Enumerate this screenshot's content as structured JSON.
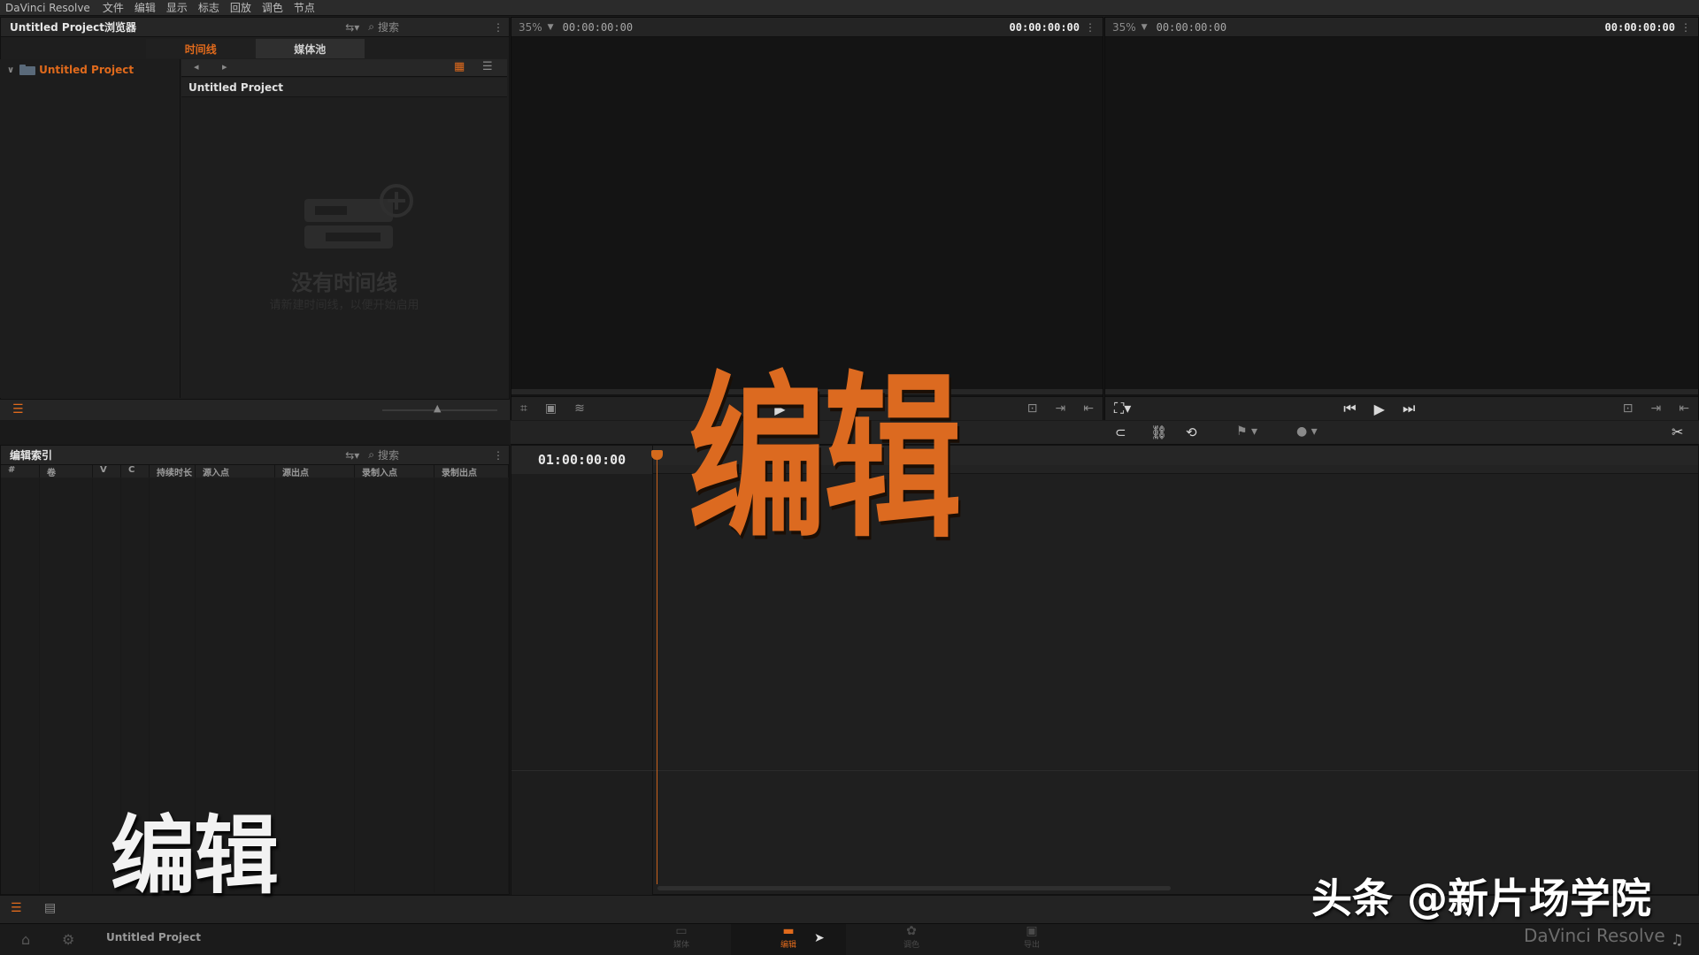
{
  "menubar": {
    "app": "DaVinci Resolve",
    "items": [
      "文件",
      "编辑",
      "显示",
      "标志",
      "回放",
      "调色",
      "节点"
    ]
  },
  "browser": {
    "title": "Untitled Project浏览器",
    "search_placeholder": "搜索",
    "tabs": [
      "时间线",
      "媒体池"
    ],
    "tree_root": "Untitled Project",
    "bin_title": "Untitled Project",
    "empty_title": "没有时间线",
    "empty_hint": "请新建时间线，以便开始启用"
  },
  "source_viewer": {
    "zoom": "35%",
    "timecode_left": "00:00:00:00",
    "timecode_right": "00:00:00:00"
  },
  "record_viewer": {
    "zoom": "35%",
    "timecode_left": "00:00:00:00",
    "timecode_right": "00:00:00:00"
  },
  "edit_index": {
    "title": "编辑索引",
    "search_placeholder": "搜索",
    "columns": [
      "#",
      "卷",
      "V",
      "C",
      "持续时长",
      "源入点",
      "源出点",
      "录制入点",
      "录制出点"
    ]
  },
  "timeline": {
    "timecode": "01:00:00:00"
  },
  "footer": {
    "project_name": "Untitled Project",
    "pages": [
      "媒体",
      "编辑",
      "调色",
      "导出"
    ]
  },
  "overlay": {
    "big_text": "编辑",
    "small_text": "编辑",
    "watermark": "头条 @新片场学院",
    "watermark_sub": "DaVinci Resolve"
  },
  "colors": {
    "accent": "#dc6a20",
    "background": "#1a1a1a"
  }
}
